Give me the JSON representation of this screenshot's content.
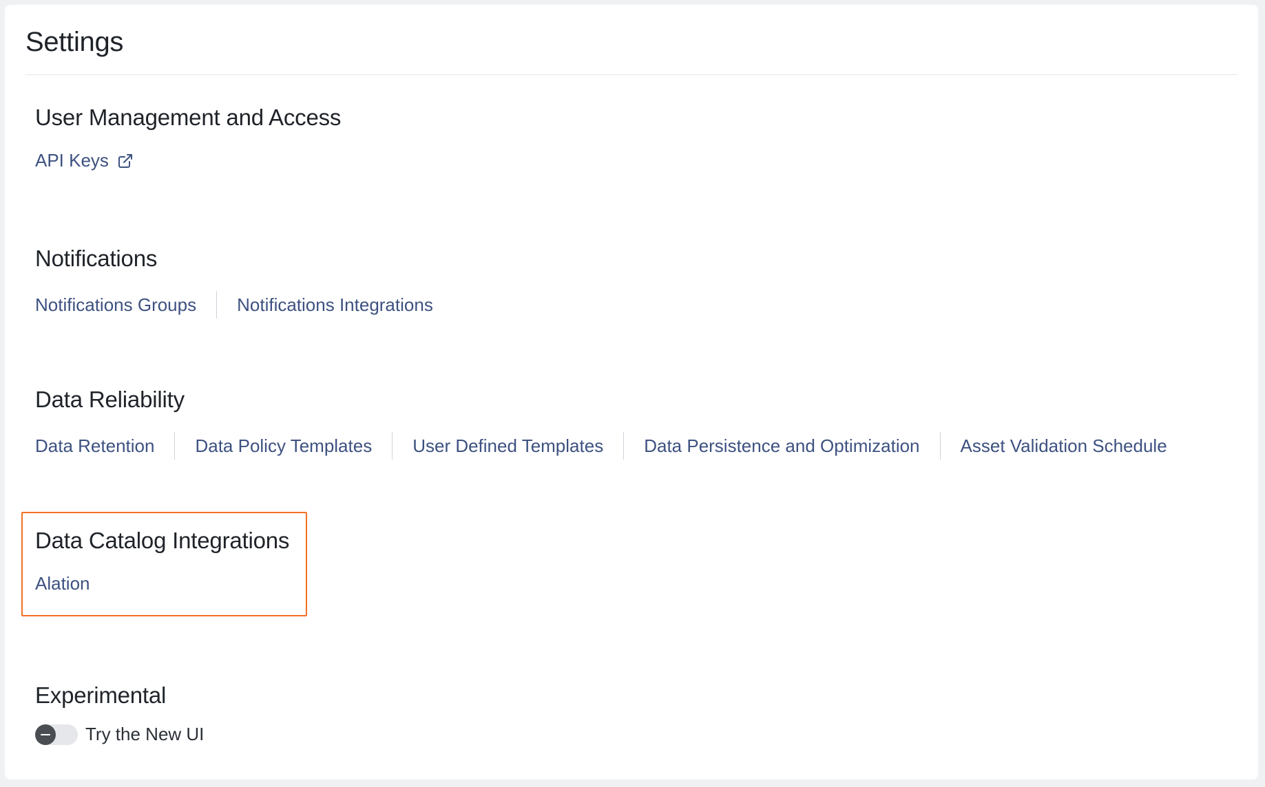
{
  "page": {
    "title": "Settings"
  },
  "sections": {
    "user_management": {
      "title": "User Management and Access",
      "links": [
        "API Keys"
      ]
    },
    "notifications": {
      "title": "Notifications",
      "links": [
        "Notifications Groups",
        "Notifications Integrations"
      ]
    },
    "data_reliability": {
      "title": "Data Reliability",
      "links": [
        "Data Retention",
        "Data Policy Templates",
        "User Defined Templates",
        "Data Persistence and Optimization",
        "Asset Validation Schedule"
      ]
    },
    "data_catalog": {
      "title": "Data Catalog Integrations",
      "links": [
        "Alation"
      ]
    },
    "experimental": {
      "title": "Experimental",
      "toggle_label": "Try the New UI",
      "toggle_on": false
    }
  },
  "icons": {
    "api_keys_external": "external-link-icon"
  },
  "colors": {
    "link": "#3d5180",
    "highlight_border": "#f36f21",
    "heading": "#1f2329"
  }
}
